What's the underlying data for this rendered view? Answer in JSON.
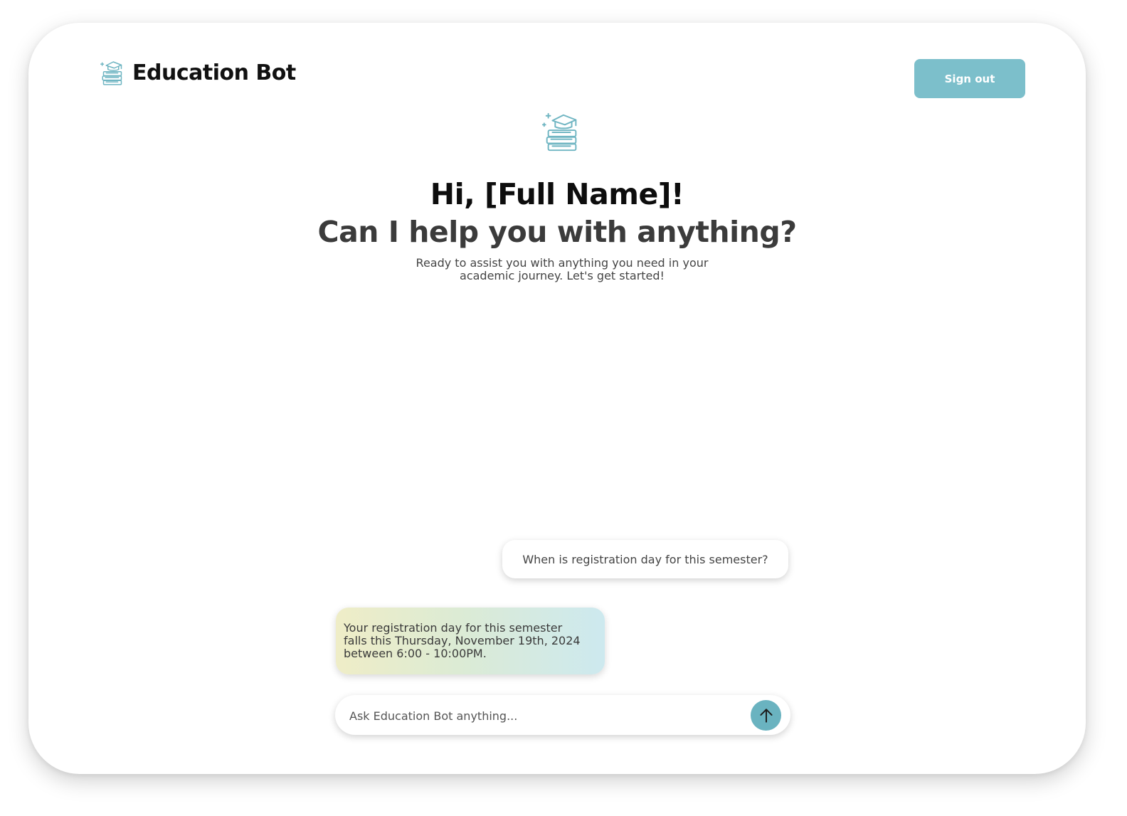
{
  "header": {
    "app_name": "Education Bot",
    "brand_icon": "graduation-cap-books-icon",
    "signout_label": "Sign out"
  },
  "hero": {
    "icon": "graduation-cap-books-icon",
    "greeting": "Hi, [Full Name]!",
    "question": "Can I help you with anything?",
    "subtitle_line1": "Ready to assist you with anything you need in your",
    "subtitle_line2": "academic journey. Let's get started!"
  },
  "chat": {
    "messages": [
      {
        "role": "user",
        "text": "When is registration day for this semester?"
      },
      {
        "role": "bot",
        "lines": [
          "Your registration day for this semester",
          "falls this Thursday, November 19th, 2024",
          "between 6:00 - 10:00PM."
        ]
      }
    ]
  },
  "composer": {
    "placeholder": "Ask Education Bot anything...",
    "value": "",
    "send_icon": "arrow-up-icon"
  },
  "colors": {
    "accent": "#7cbfcb",
    "send_button": "#6ab3c0",
    "icon_stroke": "#6fb5c2",
    "bot_bubble_gradient": [
      "#efedc7",
      "#cde9ef"
    ]
  }
}
